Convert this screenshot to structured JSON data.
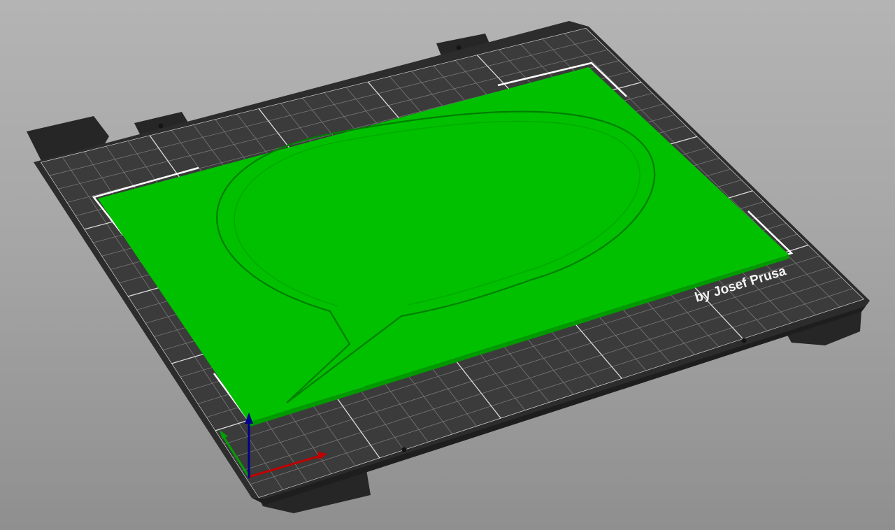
{
  "viewport": {
    "background": "#a9a9a9",
    "view": "isometric-3d"
  },
  "bed": {
    "logo_text": "by Josef Prusa",
    "frame_color": "#2f2f2f",
    "sheet_color": "#3a3a3a",
    "grid_color": "#ffffff"
  },
  "model": {
    "color": "#00c000",
    "shape": "speech-bubble-plate",
    "selected": true
  },
  "axes": {
    "x_color": "#c00000",
    "y_color": "#00a000",
    "z_color": "#00008b"
  }
}
